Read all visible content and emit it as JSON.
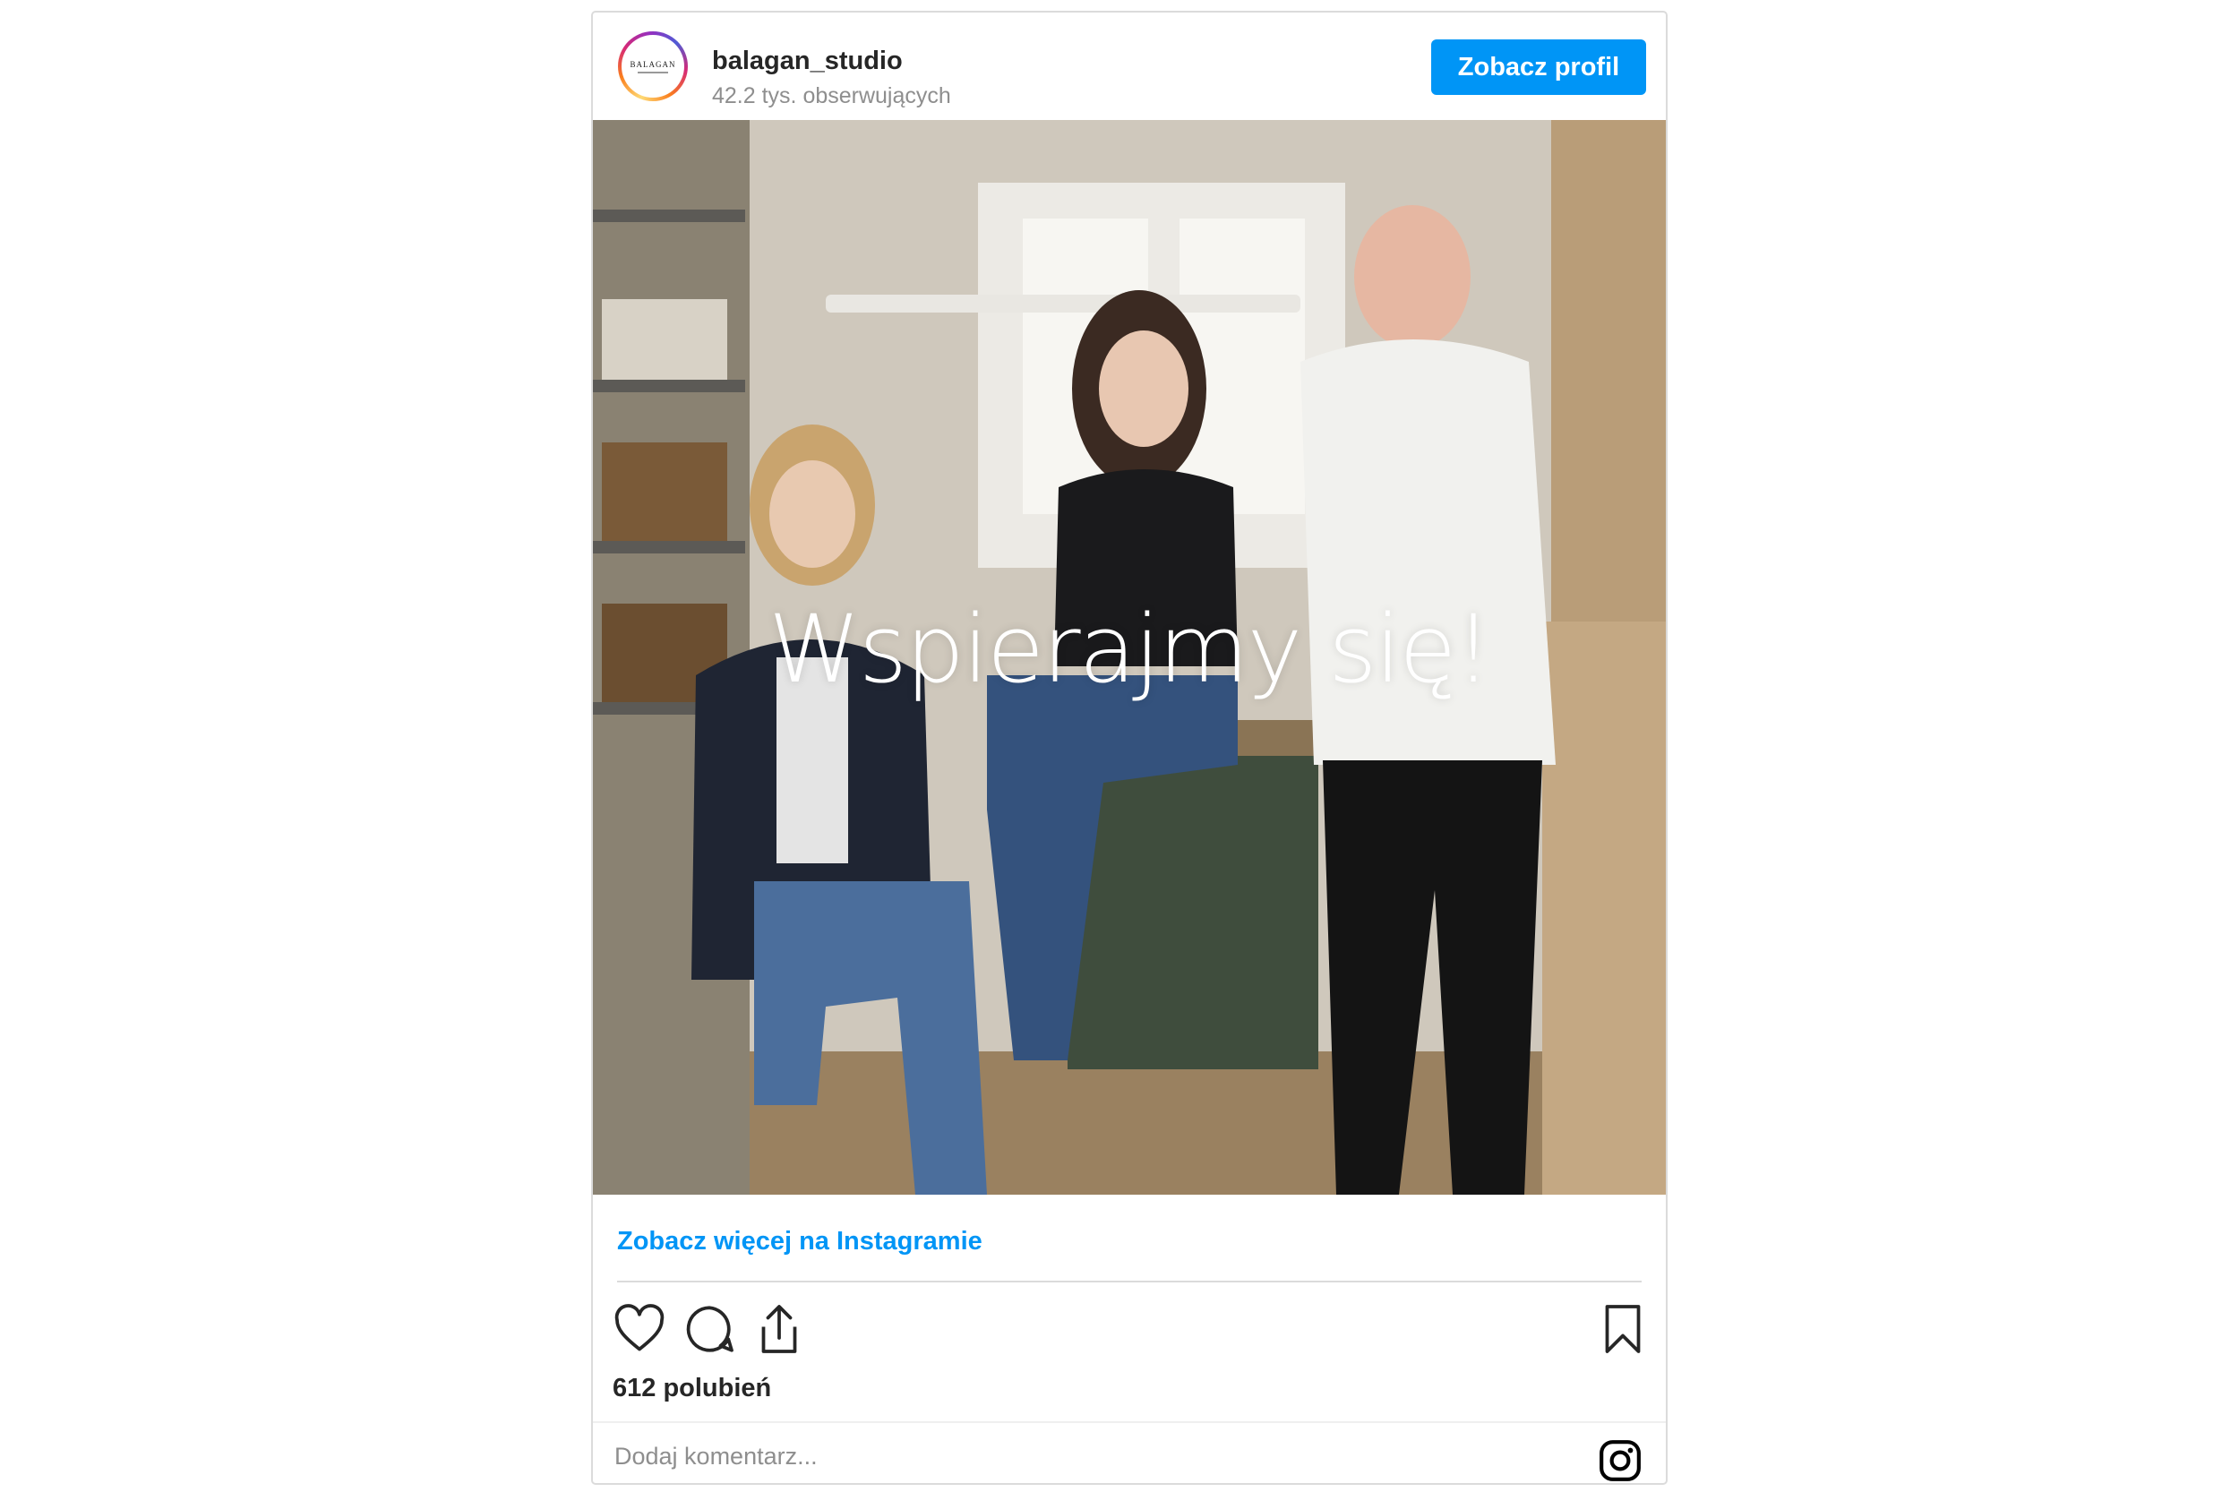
{
  "post": {
    "username": "balagan_studio",
    "followers": "42.2 tys. obserwujących",
    "avatar_text": "BALAGAN",
    "view_profile_label": "Zobacz profil",
    "image_caption": "Wspierajmy się!",
    "see_more_label": "Zobacz więcej na Instagramie",
    "likes": "612 polubień",
    "comment_placeholder": "Dodaj komentarz...",
    "icons": {
      "like": "heart-icon",
      "comment": "comment-icon",
      "share": "share-icon",
      "save": "bookmark-icon",
      "brand": "instagram-icon"
    },
    "colors": {
      "accent": "#0095f6",
      "text": "#262626",
      "muted": "#8e8e8e"
    }
  }
}
